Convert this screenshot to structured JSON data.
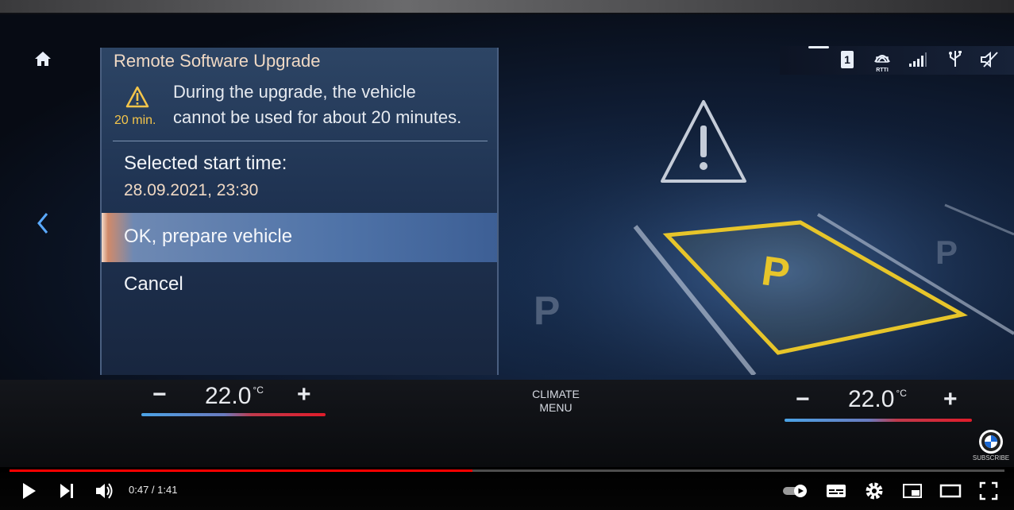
{
  "dialog": {
    "title": "Remote Software Upgrade",
    "warning_duration": "20 min.",
    "warning_line1": "During the upgrade, the vehicle",
    "warning_line2": "cannot be used for about 20 minutes.",
    "start_label": "Selected start time:",
    "start_value": "28.09.2021, 23:30",
    "menu": [
      {
        "label": "OK, prepare vehicle",
        "selected": true
      },
      {
        "label": "Cancel",
        "selected": false
      }
    ]
  },
  "status": {
    "icons": [
      "display-1-icon",
      "rtti-icon",
      "signal-strength-icon",
      "usb-icon",
      "mute-icon"
    ],
    "display_number": "1",
    "rtti_label": "RTTI"
  },
  "climate": {
    "left_temp": "22.0",
    "right_temp": "22.0",
    "unit": "°C",
    "minus": "−",
    "plus": "+",
    "menu_line1": "CLIMATE",
    "menu_line2": "MENU"
  },
  "scene": {
    "parking_label": "P"
  },
  "channel": {
    "subscribe_label": "SUBSCRIBE"
  },
  "player": {
    "current_time": "0:47",
    "duration": "1:41",
    "time_display": "0:47 / 1:41",
    "progress_fraction": 0.465,
    "colors": {
      "progress": "#ff0000",
      "accent_yellow": "#e7c52a"
    }
  }
}
